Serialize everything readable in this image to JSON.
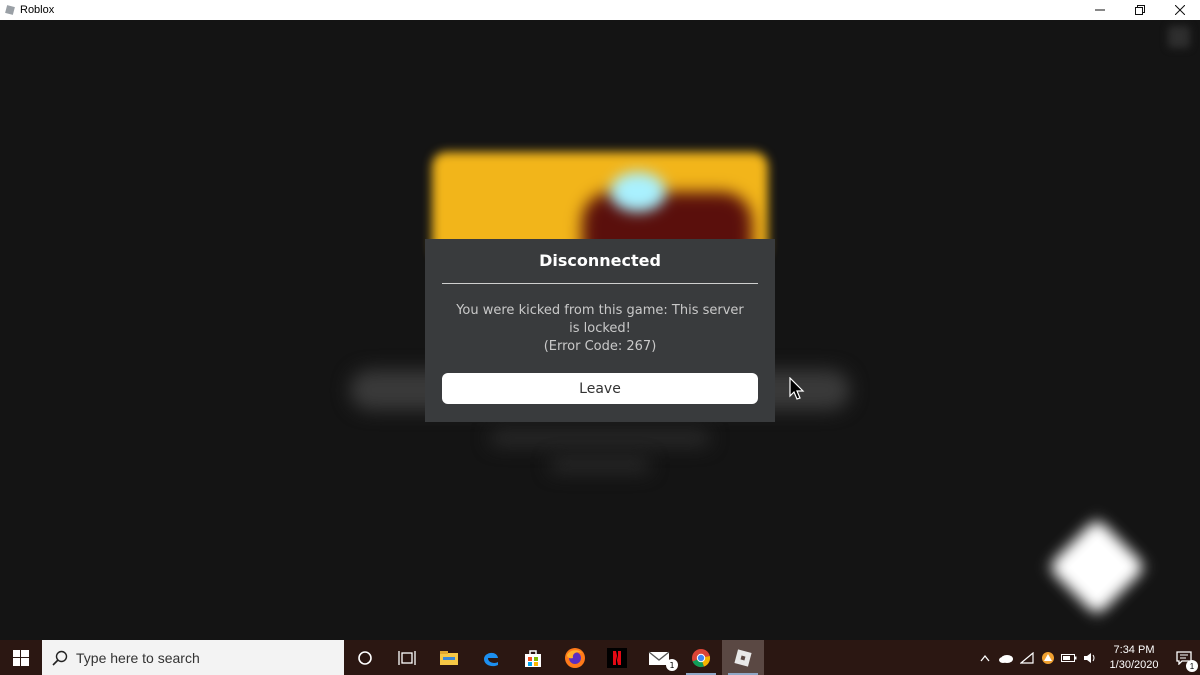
{
  "window": {
    "title": "Roblox",
    "controls": [
      "minimize-icon",
      "restore-icon",
      "close-icon"
    ]
  },
  "dialog": {
    "title": "Disconnected",
    "message_line1": "You were kicked from this game: This server is locked!",
    "message_line2": "(Error Code: 267)",
    "leave_label": "Leave"
  },
  "taskbar": {
    "search_placeholder": "Type here to search",
    "pinned": [
      "cortana-icon",
      "task-view-icon",
      "file-explorer-icon",
      "edge-icon",
      "store-icon",
      "firefox-icon",
      "netflix-icon",
      "mail-icon",
      "chrome-icon",
      "roblox-icon"
    ],
    "mail_badge": "1",
    "clock_time": "7:34 PM",
    "clock_date": "1/30/2020",
    "notification_count": "1"
  },
  "colors": {
    "dialog_bg": "#393b3d",
    "taskbar_bg": "#2b1712",
    "viewport_bg": "#141414"
  }
}
